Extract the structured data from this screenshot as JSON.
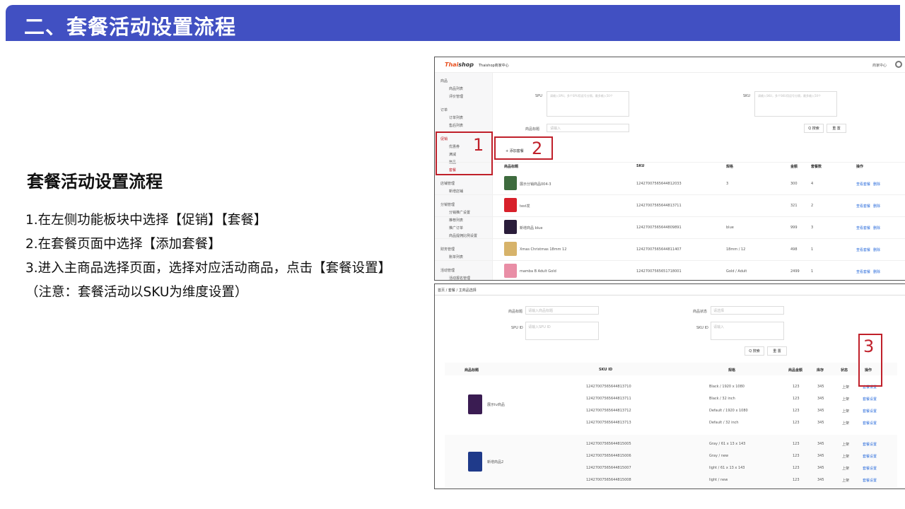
{
  "slide": {
    "banner_title": "二、套餐活动设置流程",
    "heading": "套餐活动设置流程",
    "steps": [
      "1.在左侧功能板块中选择【促销】【套餐】",
      "2.在套餐页面中选择【添加套餐】",
      "3.进入主商品选择页面，选择对应活动商品，点击【套餐设置】（注意：套餐活动以SKU为维度设置）"
    ],
    "colors": {
      "banner": "#4150c2",
      "highlight": "#c0202a"
    }
  },
  "shot1": {
    "logo_a": "Thai",
    "logo_b": "shop",
    "app_title": "Thaishop商家中心",
    "user_label": "商家中心",
    "sidebar": {
      "groups": [
        {
          "title": "商品",
          "items": [
            "商品列表",
            "评价管理"
          ]
        },
        {
          "title": "订单",
          "items": [
            "订单列表",
            "售后列表"
          ]
        },
        {
          "title": "促销",
          "items": [
            "优惠券",
            "满减",
            "赠品",
            "套餐"
          ]
        },
        {
          "title": "店铺管理",
          "items": [
            "新增店铺"
          ]
        },
        {
          "title": "分销管理",
          "items": [
            "分销推广设置",
            "推荐列表",
            "推广订单",
            "商品提佣比例设置"
          ]
        },
        {
          "title": "财务管理",
          "items": [
            "账单列表"
          ]
        },
        {
          "title": "活动管理",
          "items": [
            "活动报名管理"
          ]
        }
      ]
    },
    "form": {
      "spu_label": "SPU",
      "spu_placeholder": "请输入SPU，多个SPU用逗号分隔，最多输入50个",
      "sku_label": "SKU",
      "sku_placeholder": "请输入SKU，多个SKU用逗号分隔，最多输入50个",
      "title_label": "商品标题",
      "title_placeholder": "请输入",
      "search_btn": "Q 搜索",
      "reset_btn": "重 置",
      "add_btn": "+ 添加套餐"
    },
    "table": {
      "headers": [
        "商品标题",
        "SKU",
        "规格",
        "金额",
        "套餐数",
        "操作"
      ],
      "rows": [
        {
          "title": "展示分销商品004-3",
          "sku": "12427007565644812033",
          "spec": "3",
          "price": "300",
          "count": "4"
        },
        {
          "title": "test发",
          "sku": "12427007565644813711",
          "spec": "",
          "price": "321",
          "count": "2"
        },
        {
          "title": "新增商品 blue",
          "sku": "12427007565644809891",
          "spec": "blue",
          "price": "999",
          "count": "3"
        },
        {
          "title": "Xmas Christmas 18mm 12",
          "sku": "12427007565644811407",
          "spec": "18mm / 12",
          "price": "498",
          "count": "1"
        },
        {
          "title": "mamba B Adult Gold",
          "sku": "12427007565651718001",
          "spec": "Gold / Adult",
          "price": "2499",
          "count": "1"
        }
      ],
      "op_view": "查看套餐",
      "op_del": "删除"
    },
    "markers": [
      "1",
      "2"
    ]
  },
  "shot2": {
    "breadcrumb": "首页 / 套餐 / 主商品选择",
    "form": {
      "title_label": "商品标题",
      "title_placeholder": "请输入商品标题",
      "status_label": "商品状态",
      "status_placeholder": "请选择",
      "spu_label": "SPU ID",
      "spu_placeholder": "请输入SPU ID",
      "sku_label": "SKU ID",
      "sku_placeholder": "请输入",
      "search_btn": "Q 搜索",
      "reset_btn": "重 置"
    },
    "table": {
      "headers": [
        "商品标题",
        "SKU ID",
        "规格",
        "商品金额",
        "库存",
        "状态",
        "操作"
      ],
      "groups": [
        {
          "title": "展示tv商品",
          "rows": [
            {
              "sku": "12427007565644813710",
              "spec": "Black / 1920 x 1080",
              "price": "123",
              "stock": "345",
              "status": "上架"
            },
            {
              "sku": "12427007565644813711",
              "spec": "Black / 32 inch",
              "price": "123",
              "stock": "345",
              "status": "上架"
            },
            {
              "sku": "12427007565644813712",
              "spec": "Default / 1920 x 1080",
              "price": "123",
              "stock": "345",
              "status": "上架"
            },
            {
              "sku": "12427007565644813713",
              "spec": "Default / 32 inch",
              "price": "123",
              "stock": "345",
              "status": "上架"
            }
          ]
        },
        {
          "title": "新增商品2",
          "rows": [
            {
              "sku": "12427007565644815005",
              "spec": "Gray / 61 x 13 x 143",
              "price": "123",
              "stock": "345",
              "status": "上架"
            },
            {
              "sku": "12427007565644815006",
              "spec": "Gray / new",
              "price": "123",
              "stock": "345",
              "status": "上架"
            },
            {
              "sku": "12427007565644815007",
              "spec": "light / 61 x 13 x 143",
              "price": "123",
              "stock": "345",
              "status": "上架"
            },
            {
              "sku": "12427007565644815008",
              "spec": "light / new",
              "price": "123",
              "stock": "345",
              "status": "上架"
            }
          ]
        }
      ],
      "op": "套餐设置"
    },
    "marker": "3"
  }
}
